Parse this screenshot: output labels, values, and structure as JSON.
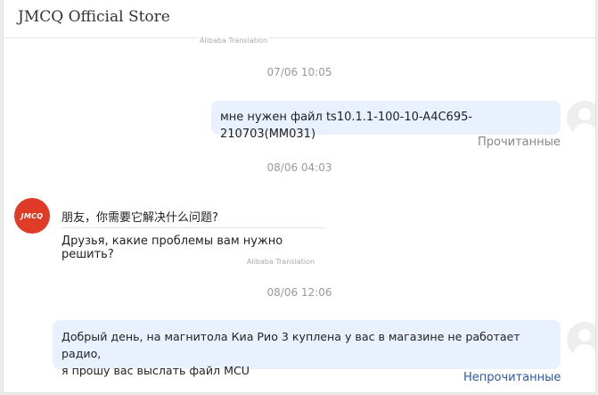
{
  "header": {
    "title": "JMCQ Official Store"
  },
  "top_translation_label": "Alibaba Translation",
  "messages": [
    {
      "time": "07/06 10:05"
    },
    {
      "text": "мне нужен файл ts10.1.1-100-10-A4C695-210703(MM031)",
      "status": "Прочитанные"
    },
    {
      "time": "08/06 04:03"
    },
    {
      "original": "朋友，你需要它解决什么问题?",
      "translated": "Друзья, какие проблемы вам нужно решить?",
      "translation_label": "Alibaba Translation"
    },
    {
      "time": "08/06 12:06"
    },
    {
      "text_line1": "Добрый день, на магнитола Киа Рио 3 куплена у вас в магазине не работает радио,",
      "text_line2": "я прошу вас выслать файл MCU",
      "status": "Непрочитанные"
    }
  ],
  "store_avatar_text": "JMCQ",
  "colors": {
    "outgoing_bubble": "#e8f1fd",
    "read_status": "#888888",
    "unread_status": "#2b59a8",
    "store_avatar": "#e03b26"
  }
}
